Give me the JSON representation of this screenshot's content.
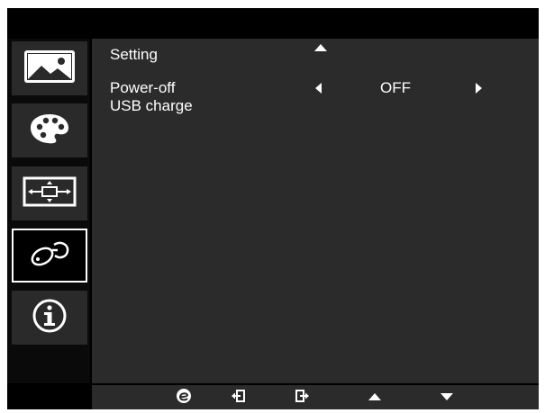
{
  "menu": {
    "section_title": "Setting",
    "setting_row": {
      "label_line1": "Power-off",
      "label_line2": "USB charge",
      "value": "OFF"
    }
  },
  "sidebar": {
    "items": [
      {
        "icon": "picture-icon",
        "selected": false
      },
      {
        "icon": "color-palette-icon",
        "selected": false
      },
      {
        "icon": "screen-position-icon",
        "selected": false
      },
      {
        "icon": "settings-wrench-icon",
        "selected": true
      },
      {
        "icon": "info-icon",
        "selected": false
      }
    ]
  },
  "bottom_buttons": [
    {
      "icon": "e-mode-icon"
    },
    {
      "icon": "input-icon"
    },
    {
      "icon": "exit-icon"
    },
    {
      "icon": "up-arrow-icon"
    },
    {
      "icon": "down-arrow-icon"
    }
  ],
  "colors": {
    "background": "#000000",
    "panel": "#2b2b2b",
    "sidebar_tile": "#2a2a2a",
    "text": "#ffffff"
  }
}
